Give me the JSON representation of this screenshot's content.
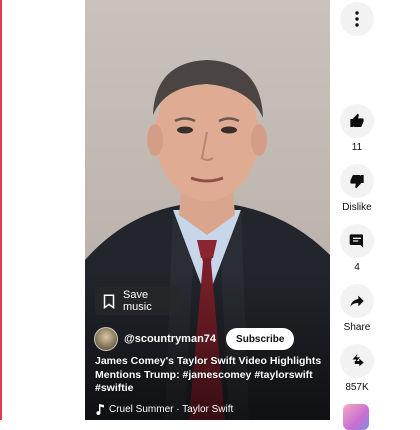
{
  "video": {
    "save_music_label": "Save music",
    "channel": {
      "handle": "@scountryman74",
      "subscribe_label": "Subscribe"
    },
    "title_text": "James Comey's Taylor Swift Video Highlights Mentions Trump:",
    "hashtags": [
      "#jamescomey",
      "#taylorswift",
      "#swiftie"
    ],
    "music": "Cruel Summer · Taylor Swift"
  },
  "actions": {
    "more_icon": "more-vert-icon",
    "like": {
      "icon": "thumb-up-icon",
      "count": "11"
    },
    "dislike": {
      "icon": "thumb-down-icon",
      "label": "Dislike"
    },
    "comments": {
      "icon": "comment-icon",
      "count": "4"
    },
    "share": {
      "icon": "share-icon",
      "label": "Share"
    },
    "remix": {
      "icon": "remix-icon",
      "count": "857K"
    }
  },
  "colors": {
    "accent_edge": "#e5394a",
    "icon_bg": "#f2f2f2",
    "text_dark": "#0f0f0f"
  }
}
